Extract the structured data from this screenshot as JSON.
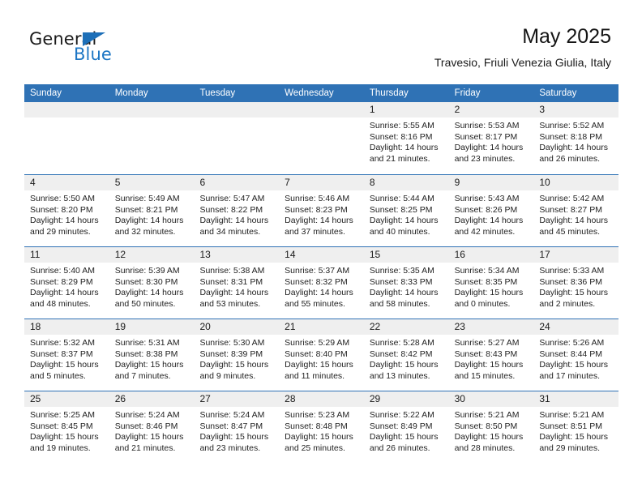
{
  "brand": {
    "name_part1": "General",
    "name_part2": "Blue",
    "triangle_color": "#1d6fb8",
    "blue_text_color": "#1d76c4"
  },
  "header": {
    "title": "May 2025",
    "subtitle": "Travesio, Friuli Venezia Giulia, Italy",
    "accent_color": "#2f72b5",
    "band_color": "#efefef"
  },
  "calendar": {
    "weekday_headers": [
      "Sunday",
      "Monday",
      "Tuesday",
      "Wednesday",
      "Thursday",
      "Friday",
      "Saturday"
    ],
    "weeks": [
      [
        {
          "day": "",
          "lines": []
        },
        {
          "day": "",
          "lines": []
        },
        {
          "day": "",
          "lines": []
        },
        {
          "day": "",
          "lines": []
        },
        {
          "day": "1",
          "lines": [
            "Sunrise: 5:55 AM",
            "Sunset: 8:16 PM",
            "Daylight: 14 hours",
            "and 21 minutes."
          ]
        },
        {
          "day": "2",
          "lines": [
            "Sunrise: 5:53 AM",
            "Sunset: 8:17 PM",
            "Daylight: 14 hours",
            "and 23 minutes."
          ]
        },
        {
          "day": "3",
          "lines": [
            "Sunrise: 5:52 AM",
            "Sunset: 8:18 PM",
            "Daylight: 14 hours",
            "and 26 minutes."
          ]
        }
      ],
      [
        {
          "day": "4",
          "lines": [
            "Sunrise: 5:50 AM",
            "Sunset: 8:20 PM",
            "Daylight: 14 hours",
            "and 29 minutes."
          ]
        },
        {
          "day": "5",
          "lines": [
            "Sunrise: 5:49 AM",
            "Sunset: 8:21 PM",
            "Daylight: 14 hours",
            "and 32 minutes."
          ]
        },
        {
          "day": "6",
          "lines": [
            "Sunrise: 5:47 AM",
            "Sunset: 8:22 PM",
            "Daylight: 14 hours",
            "and 34 minutes."
          ]
        },
        {
          "day": "7",
          "lines": [
            "Sunrise: 5:46 AM",
            "Sunset: 8:23 PM",
            "Daylight: 14 hours",
            "and 37 minutes."
          ]
        },
        {
          "day": "8",
          "lines": [
            "Sunrise: 5:44 AM",
            "Sunset: 8:25 PM",
            "Daylight: 14 hours",
            "and 40 minutes."
          ]
        },
        {
          "day": "9",
          "lines": [
            "Sunrise: 5:43 AM",
            "Sunset: 8:26 PM",
            "Daylight: 14 hours",
            "and 42 minutes."
          ]
        },
        {
          "day": "10",
          "lines": [
            "Sunrise: 5:42 AM",
            "Sunset: 8:27 PM",
            "Daylight: 14 hours",
            "and 45 minutes."
          ]
        }
      ],
      [
        {
          "day": "11",
          "lines": [
            "Sunrise: 5:40 AM",
            "Sunset: 8:29 PM",
            "Daylight: 14 hours",
            "and 48 minutes."
          ]
        },
        {
          "day": "12",
          "lines": [
            "Sunrise: 5:39 AM",
            "Sunset: 8:30 PM",
            "Daylight: 14 hours",
            "and 50 minutes."
          ]
        },
        {
          "day": "13",
          "lines": [
            "Sunrise: 5:38 AM",
            "Sunset: 8:31 PM",
            "Daylight: 14 hours",
            "and 53 minutes."
          ]
        },
        {
          "day": "14",
          "lines": [
            "Sunrise: 5:37 AM",
            "Sunset: 8:32 PM",
            "Daylight: 14 hours",
            "and 55 minutes."
          ]
        },
        {
          "day": "15",
          "lines": [
            "Sunrise: 5:35 AM",
            "Sunset: 8:33 PM",
            "Daylight: 14 hours",
            "and 58 minutes."
          ]
        },
        {
          "day": "16",
          "lines": [
            "Sunrise: 5:34 AM",
            "Sunset: 8:35 PM",
            "Daylight: 15 hours",
            "and 0 minutes."
          ]
        },
        {
          "day": "17",
          "lines": [
            "Sunrise: 5:33 AM",
            "Sunset: 8:36 PM",
            "Daylight: 15 hours",
            "and 2 minutes."
          ]
        }
      ],
      [
        {
          "day": "18",
          "lines": [
            "Sunrise: 5:32 AM",
            "Sunset: 8:37 PM",
            "Daylight: 15 hours",
            "and 5 minutes."
          ]
        },
        {
          "day": "19",
          "lines": [
            "Sunrise: 5:31 AM",
            "Sunset: 8:38 PM",
            "Daylight: 15 hours",
            "and 7 minutes."
          ]
        },
        {
          "day": "20",
          "lines": [
            "Sunrise: 5:30 AM",
            "Sunset: 8:39 PM",
            "Daylight: 15 hours",
            "and 9 minutes."
          ]
        },
        {
          "day": "21",
          "lines": [
            "Sunrise: 5:29 AM",
            "Sunset: 8:40 PM",
            "Daylight: 15 hours",
            "and 11 minutes."
          ]
        },
        {
          "day": "22",
          "lines": [
            "Sunrise: 5:28 AM",
            "Sunset: 8:42 PM",
            "Daylight: 15 hours",
            "and 13 minutes."
          ]
        },
        {
          "day": "23",
          "lines": [
            "Sunrise: 5:27 AM",
            "Sunset: 8:43 PM",
            "Daylight: 15 hours",
            "and 15 minutes."
          ]
        },
        {
          "day": "24",
          "lines": [
            "Sunrise: 5:26 AM",
            "Sunset: 8:44 PM",
            "Daylight: 15 hours",
            "and 17 minutes."
          ]
        }
      ],
      [
        {
          "day": "25",
          "lines": [
            "Sunrise: 5:25 AM",
            "Sunset: 8:45 PM",
            "Daylight: 15 hours",
            "and 19 minutes."
          ]
        },
        {
          "day": "26",
          "lines": [
            "Sunrise: 5:24 AM",
            "Sunset: 8:46 PM",
            "Daylight: 15 hours",
            "and 21 minutes."
          ]
        },
        {
          "day": "27",
          "lines": [
            "Sunrise: 5:24 AM",
            "Sunset: 8:47 PM",
            "Daylight: 15 hours",
            "and 23 minutes."
          ]
        },
        {
          "day": "28",
          "lines": [
            "Sunrise: 5:23 AM",
            "Sunset: 8:48 PM",
            "Daylight: 15 hours",
            "and 25 minutes."
          ]
        },
        {
          "day": "29",
          "lines": [
            "Sunrise: 5:22 AM",
            "Sunset: 8:49 PM",
            "Daylight: 15 hours",
            "and 26 minutes."
          ]
        },
        {
          "day": "30",
          "lines": [
            "Sunrise: 5:21 AM",
            "Sunset: 8:50 PM",
            "Daylight: 15 hours",
            "and 28 minutes."
          ]
        },
        {
          "day": "31",
          "lines": [
            "Sunrise: 5:21 AM",
            "Sunset: 8:51 PM",
            "Daylight: 15 hours",
            "and 29 minutes."
          ]
        }
      ]
    ]
  }
}
